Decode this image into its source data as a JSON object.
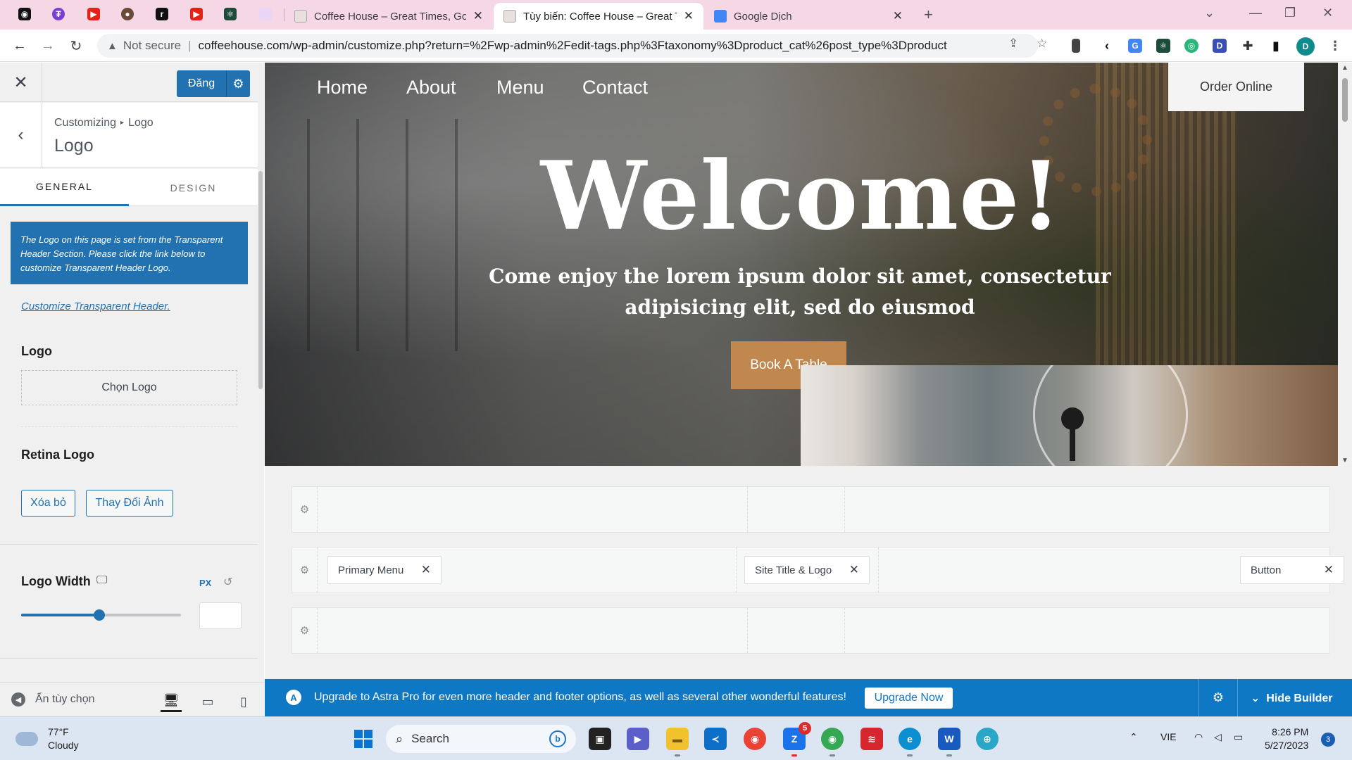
{
  "browser": {
    "tabs": [
      {
        "title": "Coffee House – Great Times, Goo",
        "active": false
      },
      {
        "title": "Tùy biến: Coffee House – Great T",
        "active": true
      },
      {
        "title": "Google Dịch",
        "active": false
      }
    ],
    "new_tab_label": "+",
    "address": {
      "security_label": "Not secure",
      "url": "coffeehouse.com/wp-admin/customize.php?return=%2Fwp-admin%2Fedit-tags.php%3Ftaxonomy%3Dproduct_cat%26post_type%3Dproduct"
    },
    "profile_initial": "D"
  },
  "customizer": {
    "publish_label": "Đăng",
    "breadcrumb_root": "Customizing",
    "breadcrumb_leaf": "Logo",
    "section_title": "Logo",
    "tabs": [
      "GENERAL",
      "DESIGN"
    ],
    "notice_text": "The Logo on this page is set from the Transparent Header Section. Please click the link below to customize Transparent Header Logo.",
    "link_text": "Customize Transparent Header.",
    "logo_label": "Logo",
    "choose_logo": "Chọn Logo",
    "retina_label": "Retina Logo",
    "remove_btn": "Xóa bỏ",
    "change_btn": "Thay Đổi Ảnh",
    "logo_width_label": "Logo Width",
    "unit": "PX",
    "logo_width_slider_fraction": 0.49,
    "hide_controls": "Ẩn tùy chọn"
  },
  "preview": {
    "nav": [
      "Home",
      "About",
      "Menu",
      "Contact"
    ],
    "order_button": "Order Online",
    "headline": "Welcome!",
    "subheadline_line1": "Come enjoy the lorem ipsum dolor sit amet, consectetur",
    "subheadline_line2": "adipisicing elit, sed do eiusmod",
    "cta": "Book A Table"
  },
  "builder": {
    "chips": {
      "primary_menu": "Primary Menu",
      "site_title_logo": "Site Title & Logo",
      "button": "Button"
    },
    "upgrade_message": "Upgrade to Astra Pro for even more header and footer options, as well as several other wonderful features!",
    "upgrade_button": "Upgrade Now",
    "hide_builder": "Hide Builder"
  },
  "taskbar": {
    "temperature": "77°F",
    "condition": "Cloudy",
    "search_placeholder": "Search",
    "language": "VIE",
    "time": "8:26 PM",
    "date": "5/27/2023",
    "notification_count": "3",
    "zalo_badge": "5"
  },
  "colors": {
    "wp_blue": "#2271b1",
    "astra_blue": "#0f78c5",
    "cta_brown": "#c0884f",
    "tab_strip_pink": "#f6d7e6"
  }
}
